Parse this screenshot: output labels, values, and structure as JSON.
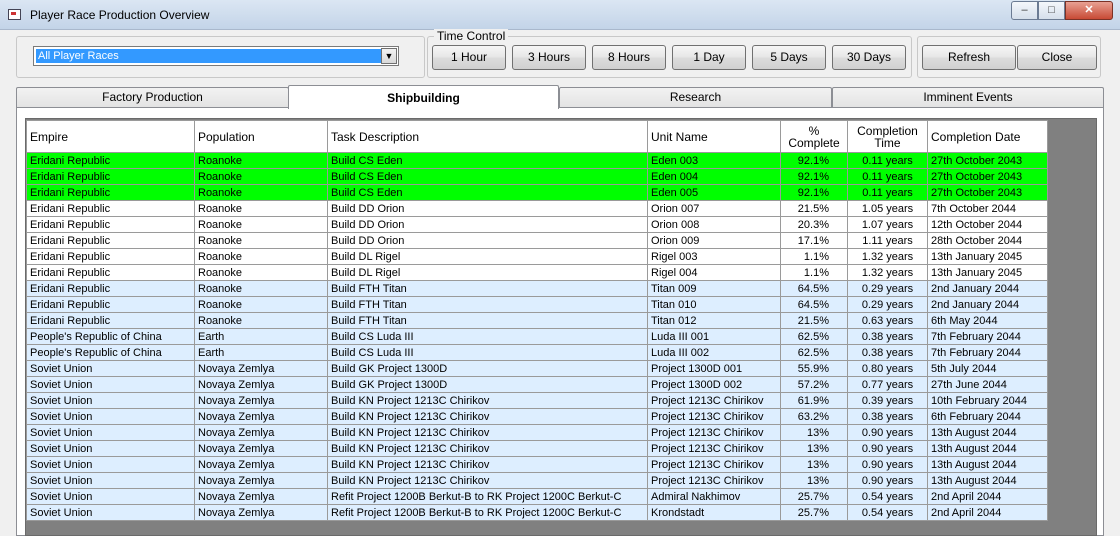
{
  "window": {
    "title": "Player Race Production Overview",
    "min_glyph": "–",
    "max_glyph": "□",
    "close_glyph": "✕"
  },
  "filter": {
    "selected": "All Player Races",
    "arrow": "▼"
  },
  "time_control": {
    "label": "Time Control",
    "buttons": [
      "1 Hour",
      "3 Hours",
      "8 Hours",
      "1 Day",
      "5 Days",
      "30 Days"
    ]
  },
  "actions": {
    "refresh": "Refresh",
    "close": "Close"
  },
  "tabs": [
    "Factory Production",
    "Shipbuilding",
    "Research",
    "Imminent Events"
  ],
  "active_tab": "Shipbuilding",
  "colors": {
    "complete_row": "#00ff00",
    "normal_row": "#ffffff",
    "group_row": "#ddeeff",
    "selection": "#3399ff"
  },
  "table": {
    "columns": [
      "Empire",
      "Population",
      "Task Description",
      "Unit Name",
      "% Complete",
      "Completion Time",
      "Completion Date"
    ],
    "rows": [
      {
        "empire": "Eridani Republic",
        "population": "Roanoke",
        "task": "Build CS Eden",
        "unit": "Eden 003",
        "pct": "92.1%",
        "time": "0.11 years",
        "date": "27th October 2043",
        "style": "green"
      },
      {
        "empire": "Eridani Republic",
        "population": "Roanoke",
        "task": "Build CS Eden",
        "unit": "Eden 004",
        "pct": "92.1%",
        "time": "0.11 years",
        "date": "27th October 2043",
        "style": "green"
      },
      {
        "empire": "Eridani Republic",
        "population": "Roanoke",
        "task": "Build CS Eden",
        "unit": "Eden 005",
        "pct": "92.1%",
        "time": "0.11 years",
        "date": "27th October 2043",
        "style": "green"
      },
      {
        "empire": "Eridani Republic",
        "population": "Roanoke",
        "task": "Build DD Orion",
        "unit": "Orion 007",
        "pct": "21.5%",
        "time": "1.05 years",
        "date": "7th October 2044",
        "style": "white"
      },
      {
        "empire": "Eridani Republic",
        "population": "Roanoke",
        "task": "Build DD Orion",
        "unit": "Orion 008",
        "pct": "20.3%",
        "time": "1.07 years",
        "date": "12th October 2044",
        "style": "white"
      },
      {
        "empire": "Eridani Republic",
        "population": "Roanoke",
        "task": "Build DD Orion",
        "unit": "Orion 009",
        "pct": "17.1%",
        "time": "1.11 years",
        "date": "28th October 2044",
        "style": "white"
      },
      {
        "empire": "Eridani Republic",
        "population": "Roanoke",
        "task": "Build DL Rigel",
        "unit": "Rigel 003",
        "pct": "1.1%",
        "time": "1.32 years",
        "date": "13th January 2045",
        "style": "white"
      },
      {
        "empire": "Eridani Republic",
        "population": "Roanoke",
        "task": "Build DL Rigel",
        "unit": "Rigel 004",
        "pct": "1.1%",
        "time": "1.32 years",
        "date": "13th January 2045",
        "style": "white"
      },
      {
        "empire": "Eridani Republic",
        "population": "Roanoke",
        "task": "Build FTH Titan",
        "unit": "Titan 009",
        "pct": "64.5%",
        "time": "0.29 years",
        "date": "2nd January 2044",
        "style": "blue"
      },
      {
        "empire": "Eridani Republic",
        "population": "Roanoke",
        "task": "Build FTH Titan",
        "unit": "Titan 010",
        "pct": "64.5%",
        "time": "0.29 years",
        "date": "2nd January 2044",
        "style": "blue"
      },
      {
        "empire": "Eridani Republic",
        "population": "Roanoke",
        "task": "Build FTH Titan",
        "unit": "Titan 012",
        "pct": "21.5%",
        "time": "0.63 years",
        "date": "6th May 2044",
        "style": "blue"
      },
      {
        "empire": "People's Republic of China",
        "population": "Earth",
        "task": "Build CS Luda III",
        "unit": "Luda III 001",
        "pct": "62.5%",
        "time": "0.38 years",
        "date": "7th February 2044",
        "style": "blue"
      },
      {
        "empire": "People's Republic of China",
        "population": "Earth",
        "task": "Build CS Luda III",
        "unit": "Luda III 002",
        "pct": "62.5%",
        "time": "0.38 years",
        "date": "7th February 2044",
        "style": "blue"
      },
      {
        "empire": "Soviet Union",
        "population": "Novaya Zemlya",
        "task": "Build GK Project 1300D",
        "unit": "Project 1300D 001",
        "pct": "55.9%",
        "time": "0.80 years",
        "date": "5th July 2044",
        "style": "blue"
      },
      {
        "empire": "Soviet Union",
        "population": "Novaya Zemlya",
        "task": "Build GK Project 1300D",
        "unit": "Project 1300D 002",
        "pct": "57.2%",
        "time": "0.77 years",
        "date": "27th June 2044",
        "style": "blue"
      },
      {
        "empire": "Soviet Union",
        "population": "Novaya Zemlya",
        "task": "Build KN Project 1213C Chirikov",
        "unit": "Project 1213C Chirikov",
        "pct": "61.9%",
        "time": "0.39 years",
        "date": "10th February 2044",
        "style": "blue"
      },
      {
        "empire": "Soviet Union",
        "population": "Novaya Zemlya",
        "task": "Build KN Project 1213C Chirikov",
        "unit": "Project 1213C Chirikov",
        "pct": "63.2%",
        "time": "0.38 years",
        "date": "6th February 2044",
        "style": "blue"
      },
      {
        "empire": "Soviet Union",
        "population": "Novaya Zemlya",
        "task": "Build KN Project 1213C Chirikov",
        "unit": "Project 1213C Chirikov",
        "pct": "13%",
        "time": "0.90 years",
        "date": "13th August 2044",
        "style": "blue"
      },
      {
        "empire": "Soviet Union",
        "population": "Novaya Zemlya",
        "task": "Build KN Project 1213C Chirikov",
        "unit": "Project 1213C Chirikov",
        "pct": "13%",
        "time": "0.90 years",
        "date": "13th August 2044",
        "style": "blue"
      },
      {
        "empire": "Soviet Union",
        "population": "Novaya Zemlya",
        "task": "Build KN Project 1213C Chirikov",
        "unit": "Project 1213C Chirikov",
        "pct": "13%",
        "time": "0.90 years",
        "date": "13th August 2044",
        "style": "blue"
      },
      {
        "empire": "Soviet Union",
        "population": "Novaya Zemlya",
        "task": "Build KN Project 1213C Chirikov",
        "unit": "Project 1213C Chirikov",
        "pct": "13%",
        "time": "0.90 years",
        "date": "13th August 2044",
        "style": "blue"
      },
      {
        "empire": "Soviet Union",
        "population": "Novaya Zemlya",
        "task": "Refit Project 1200B Berkut-B to RK Project 1200C Berkut-C",
        "unit": "Admiral Nakhimov",
        "pct": "25.7%",
        "time": "0.54 years",
        "date": "2nd April 2044",
        "style": "blue"
      },
      {
        "empire": "Soviet Union",
        "population": "Novaya Zemlya",
        "task": "Refit Project 1200B Berkut-B to RK Project 1200C Berkut-C",
        "unit": "Krondstadt",
        "pct": "25.7%",
        "time": "0.54 years",
        "date": "2nd April 2044",
        "style": "blue"
      }
    ]
  }
}
